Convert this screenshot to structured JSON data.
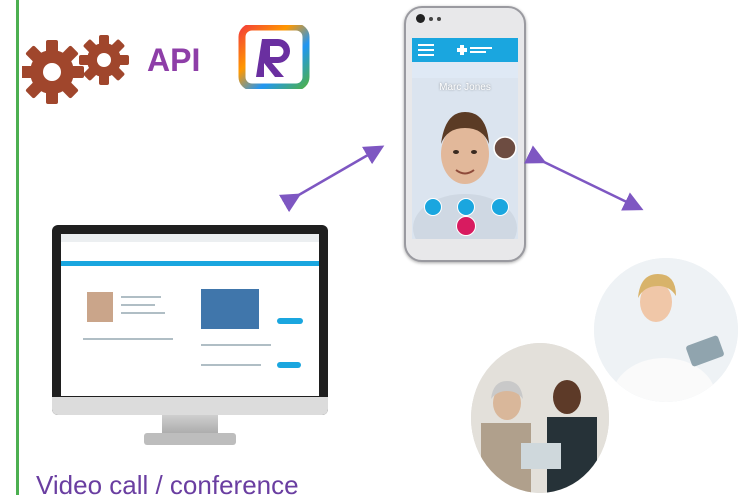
{
  "api": {
    "label": "API"
  },
  "phone": {
    "callee_name": "Marc Jones"
  },
  "caption": "Video call / conference",
  "colors": {
    "api_gear": "#a0462c",
    "api_text": "#8e3ea8",
    "arrow": "#7e57c2",
    "accent_blue": "#1aa6df",
    "hangup": "#d81b60",
    "left_rule": "#4caf50"
  },
  "icons": [
    "gear-icon",
    "r-logo-icon",
    "microphone-icon",
    "speaker-icon",
    "camera-icon",
    "hangup-icon",
    "menu-icon"
  ]
}
